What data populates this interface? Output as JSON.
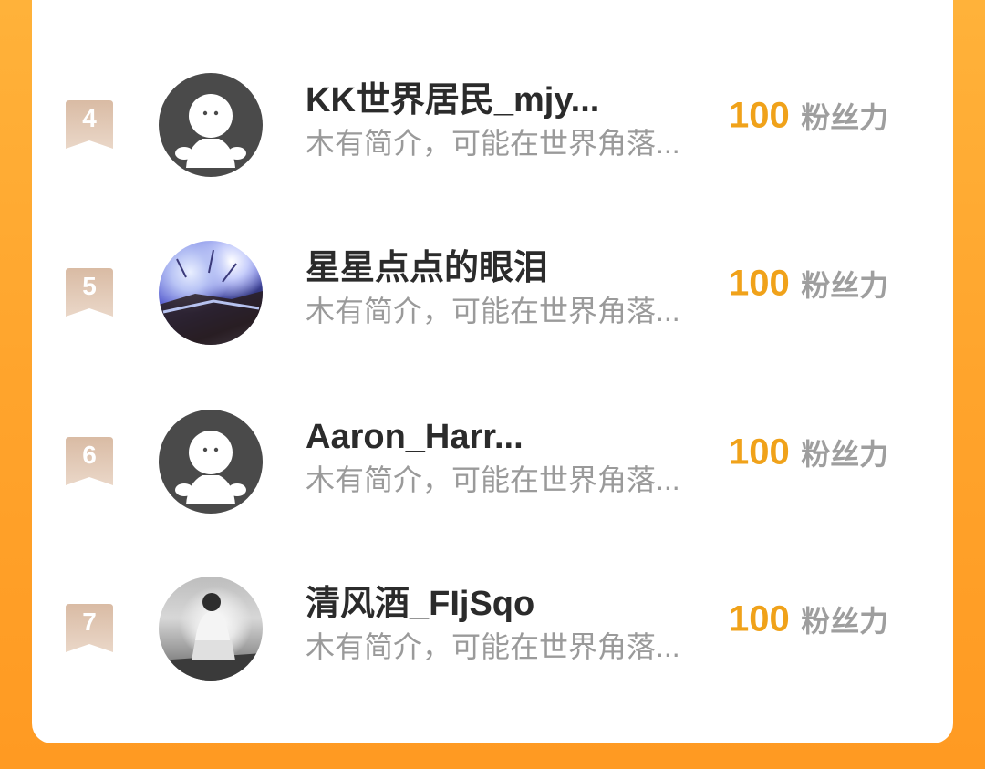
{
  "leaderboard": {
    "rows": [
      {
        "rank": "4",
        "name": "KK世界居民_mjy...",
        "bio": "木有简介，可能在世界角落...",
        "score": "100",
        "unit": "粉丝力",
        "avatar": "default-avatar"
      },
      {
        "rank": "5",
        "name": "星星点点的眼泪",
        "bio": "木有简介，可能在世界角落...",
        "score": "100",
        "unit": "粉丝力",
        "avatar": "photo-avatar"
      },
      {
        "rank": "6",
        "name": "Aaron_Harr...",
        "bio": "木有简介，可能在世界角落...",
        "score": "100",
        "unit": "粉丝力",
        "avatar": "default-avatar"
      },
      {
        "rank": "7",
        "name": "清风酒_FIjSqo",
        "bio": "木有简介，可能在世界角落...",
        "score": "100",
        "unit": "粉丝力",
        "avatar": "photo-avatar"
      }
    ]
  },
  "colors": {
    "background_orange": "#ffa42c",
    "score": "#f0a21a",
    "badge": "#d8b8a0",
    "name": "#2b2b2b",
    "bio": "#9a9a9a",
    "unit": "#9e9e9e"
  }
}
